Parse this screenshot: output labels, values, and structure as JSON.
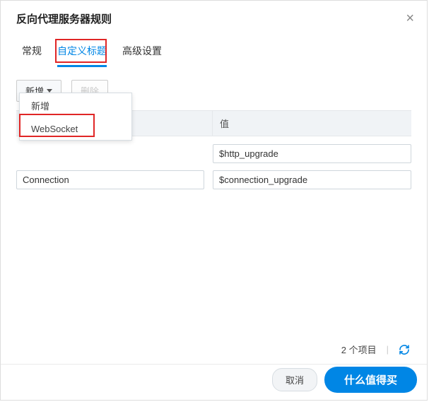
{
  "dialog": {
    "title": "反向代理服务器规则"
  },
  "tabs": {
    "general": "常规",
    "custom_headers": "自定义标题",
    "advanced": "高级设置"
  },
  "toolbar": {
    "add_label": "新增",
    "delete_label": "删除"
  },
  "dropdown": {
    "items": {
      "0": "新增",
      "1": "WebSocket"
    }
  },
  "table": {
    "headers": {
      "name": "",
      "value": "值"
    },
    "rows": [
      {
        "name": "",
        "value": "$http_upgrade"
      },
      {
        "name": "Connection",
        "value": "$connection_upgrade"
      }
    ]
  },
  "footer": {
    "count_text": "2 个项目",
    "cancel": "取消",
    "ok": "什么值得买"
  },
  "watermark": "值"
}
